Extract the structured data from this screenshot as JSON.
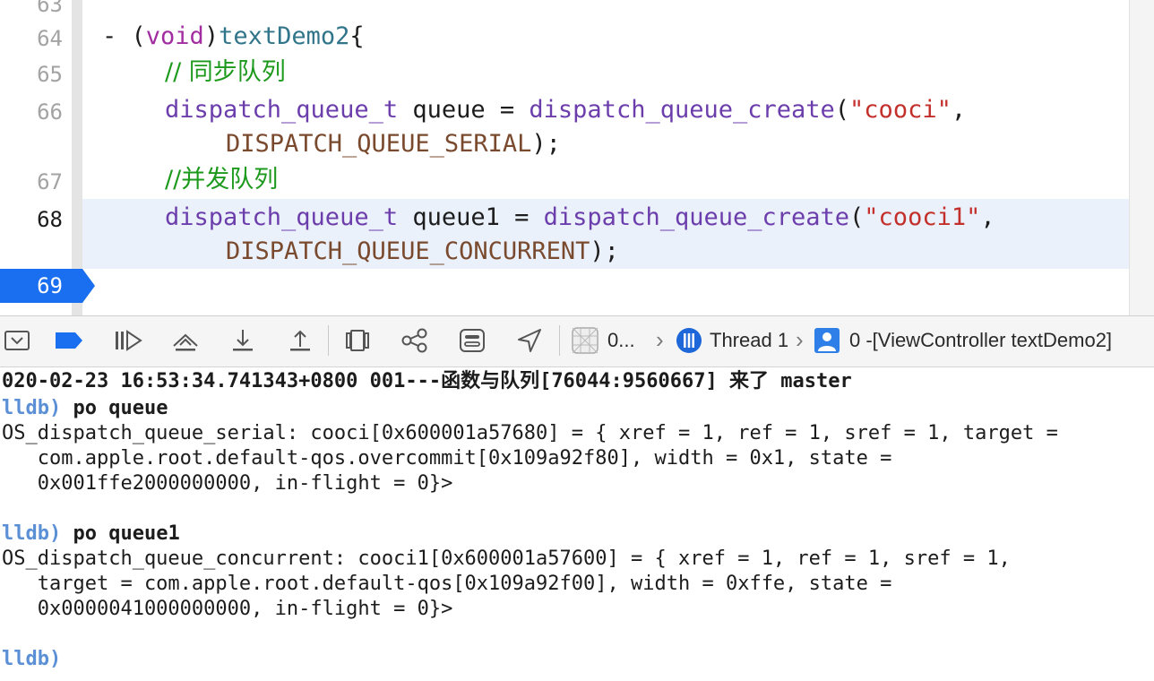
{
  "editor": {
    "line_numbers": [
      "63",
      "64",
      "65",
      "66",
      "67",
      "68",
      "69"
    ],
    "current_line": "68",
    "breakpoint_line": "69",
    "code": {
      "l64_dash": "- (",
      "l64_void": "void",
      "l64_paren": ")",
      "l64_name": "textDemo2",
      "l64_brace": "{",
      "l65_comment": "// 同步队列",
      "l66_type": "dispatch_queue_t",
      "l66_var": " queue = ",
      "l66_fn": "dispatch_queue_create",
      "l66_open": "(",
      "l66_str": "\"cooci\"",
      "l66_comma": ",",
      "l66b_macro": "DISPATCH_QUEUE_SERIAL",
      "l66b_end": ");",
      "l67_comment": "//并发队列",
      "l68_type": "dispatch_queue_t",
      "l68_var": " queue1 = ",
      "l68_fn": "dispatch_queue_create",
      "l68_open": "(",
      "l68_str": "\"cooci1\"",
      "l68_comma": ",",
      "l68b_macro": "DISPATCH_QUEUE_CONCURRENT",
      "l68b_end": ");"
    }
  },
  "toolbar": {
    "crumb_frame": "0...",
    "thread_label": "Thread 1",
    "frame_label": "0 -[ViewController textDemo2]",
    "icons": [
      "hide-debug-area-icon",
      "breakpoints-toggle-icon",
      "continue-icon",
      "step-over-icon",
      "step-into-icon",
      "step-out-icon",
      "view-debugger-icon",
      "memory-graph-icon",
      "environment-overrides-icon",
      "simulate-location-icon"
    ]
  },
  "console": {
    "log_line": "020-02-23 16:53:34.741343+0800 001---函数与队列[76044:9560667] 来了 master",
    "prompt1": "lldb)",
    "cmd1": " po queue",
    "out1_l1": "OS_dispatch_queue_serial: cooci[0x600001a57680] = { xref = 1, ref = 1, sref = 1, target =",
    "out1_l2": "   com.apple.root.default-qos.overcommit[0x109a92f80], width = 0x1, state =",
    "out1_l3": "   0x001ffe2000000000, in-flight = 0}>",
    "prompt2": "lldb)",
    "cmd2": " po queue1",
    "out2_l1": "OS_dispatch_queue_concurrent: cooci1[0x600001a57600] = { xref = 1, ref = 1, sref = 1,",
    "out2_l2": "   target = com.apple.root.default-qos[0x109a92f00], width = 0xffe, state =",
    "out2_l3": "   0x0000041000000000, in-flight = 0}>",
    "prompt3": "lldb)"
  },
  "colors": {
    "keyword": "#a12da0",
    "function_name": "#31758a",
    "comment": "#1d9a1d",
    "type": "#6c3eac",
    "macro": "#7a4a2e",
    "string": "#c3302b",
    "breakpoint": "#1a6ff0",
    "lldb_prompt": "#5b8fd6"
  }
}
